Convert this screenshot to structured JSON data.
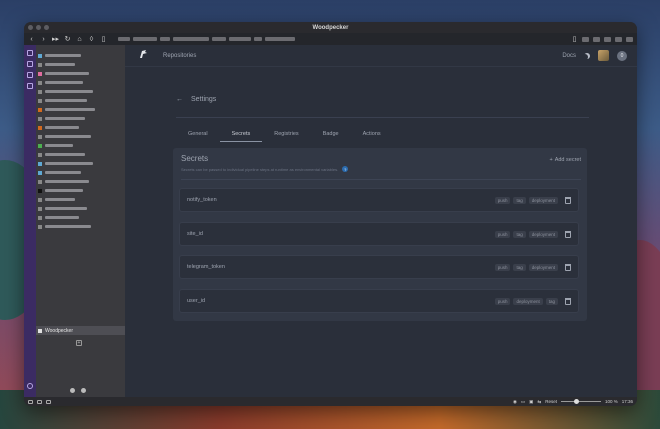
{
  "window": {
    "title": "Woodpecker"
  },
  "browser": {
    "reset_label": "Reset",
    "zoom_level": "100 %",
    "zoom_fraction": 0.33,
    "clock": "17:36",
    "active_tab_title": "Woodpecker"
  },
  "nav": {
    "repositories": "Repositories",
    "docs": "Docs",
    "notification_count": "0"
  },
  "settings": {
    "title": "Settings",
    "tabs": [
      "General",
      "Secrets",
      "Registries",
      "Badge",
      "Actions"
    ],
    "active_tab": "Secrets"
  },
  "secrets": {
    "title": "Secrets",
    "description": "Secrets can be passed to individual pipeline steps at runtime as environmental variables.",
    "add_label": "Add secret",
    "items": [
      {
        "name": "notify_token",
        "events": [
          "push",
          "tag",
          "deployment"
        ]
      },
      {
        "name": "site_id",
        "events": [
          "push",
          "tag",
          "deployment"
        ]
      },
      {
        "name": "telegram_token",
        "events": [
          "push",
          "tag",
          "deployment"
        ]
      },
      {
        "name": "user_id",
        "events": [
          "push",
          "deployment",
          "tag"
        ]
      }
    ]
  },
  "colors": {
    "sidebar_strip": "#3b2b63",
    "info_icon": "#2b6cb0"
  }
}
